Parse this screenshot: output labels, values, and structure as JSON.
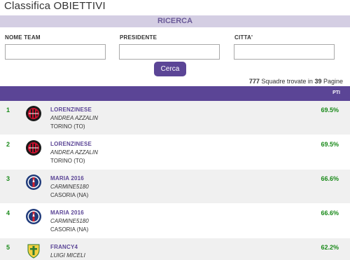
{
  "page": {
    "title": "Classifica OBIETTIVI"
  },
  "search": {
    "band_title": "RICERCA",
    "fields": [
      {
        "label": "NOME TEAM",
        "value": ""
      },
      {
        "label": "PRESIDENTE",
        "value": ""
      },
      {
        "label": "CITTA'",
        "value": ""
      }
    ],
    "button_label": "Cerca"
  },
  "results": {
    "teams_count": "777",
    "teams_text": "Squadre trovate in",
    "pages_count": "39",
    "pages_text": "Pagine"
  },
  "table": {
    "header_score_label": "PTI",
    "rows": [
      {
        "rank": "1",
        "team": "LORENZINESE",
        "president": "ANDREA AZZALIN",
        "city": "TORINO  (TO)",
        "score": "69.5%",
        "logo": "milan-crest-icon"
      },
      {
        "rank": "2",
        "team": "LORENZINESE",
        "president": "ANDREA AZZALIN",
        "city": "TORINO  (TO)",
        "score": "69.5%",
        "logo": "milan-crest-icon"
      },
      {
        "rank": "3",
        "team": "MARIA 2016",
        "president": "CARMINE5180",
        "city": "CASORIA  (NA)",
        "score": "66.6%",
        "logo": "psg-crest-icon"
      },
      {
        "rank": "4",
        "team": "MARIA 2016",
        "president": "CARMINE5180",
        "city": "CASORIA  (NA)",
        "score": "66.6%",
        "logo": "psg-crest-icon"
      },
      {
        "rank": "5",
        "team": "FRANCY4",
        "president": "LUIGI MICELI",
        "city": "",
        "score": "62.2%",
        "logo": "cross-crest-icon"
      }
    ]
  },
  "colors": {
    "accent": "#5b4596",
    "band": "#d4cee3",
    "score_green": "#1a8a1a"
  }
}
